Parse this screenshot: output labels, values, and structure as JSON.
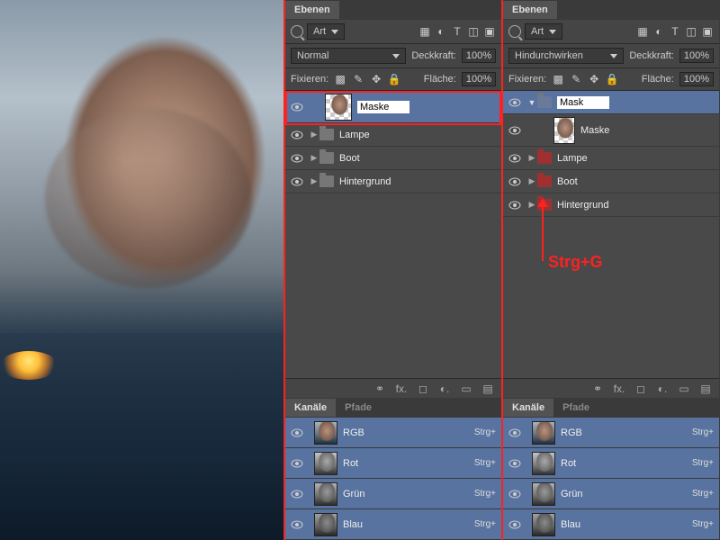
{
  "panelLeft": {
    "tab": "Ebenen",
    "filter": "Art",
    "blendMode": "Normal",
    "opacityLabel": "Deckkraft:",
    "opacity": "100%",
    "lockLabel": "Fixieren:",
    "fillLabel": "Fläche:",
    "fill": "100%",
    "editValue": "Maske",
    "layers": [
      {
        "name": "Lampe"
      },
      {
        "name": "Boot"
      },
      {
        "name": "Hintergrund"
      }
    ]
  },
  "panelRight": {
    "tab": "Ebenen",
    "filter": "Art",
    "blendMode": "Hindurchwirken",
    "opacityLabel": "Deckkraft:",
    "opacity": "100%",
    "lockLabel": "Fixieren:",
    "fillLabel": "Fläche:",
    "fill": "100%",
    "groupEdit": "Mask",
    "childLayer": "Maske",
    "layers": [
      {
        "name": "Lampe"
      },
      {
        "name": "Boot"
      },
      {
        "name": "Hintergrund"
      }
    ]
  },
  "channelsPanel": {
    "tab1": "Kanäle",
    "tab2": "Pfade",
    "channels": [
      {
        "name": "RGB",
        "shortcut": "Strg+"
      },
      {
        "name": "Rot",
        "shortcut": "Strg+"
      },
      {
        "name": "Grün",
        "shortcut": "Strg+"
      },
      {
        "name": "Blau",
        "shortcut": "Strg+"
      }
    ]
  },
  "annotation": "Strg+G",
  "icons": {
    "fx": "fx."
  }
}
